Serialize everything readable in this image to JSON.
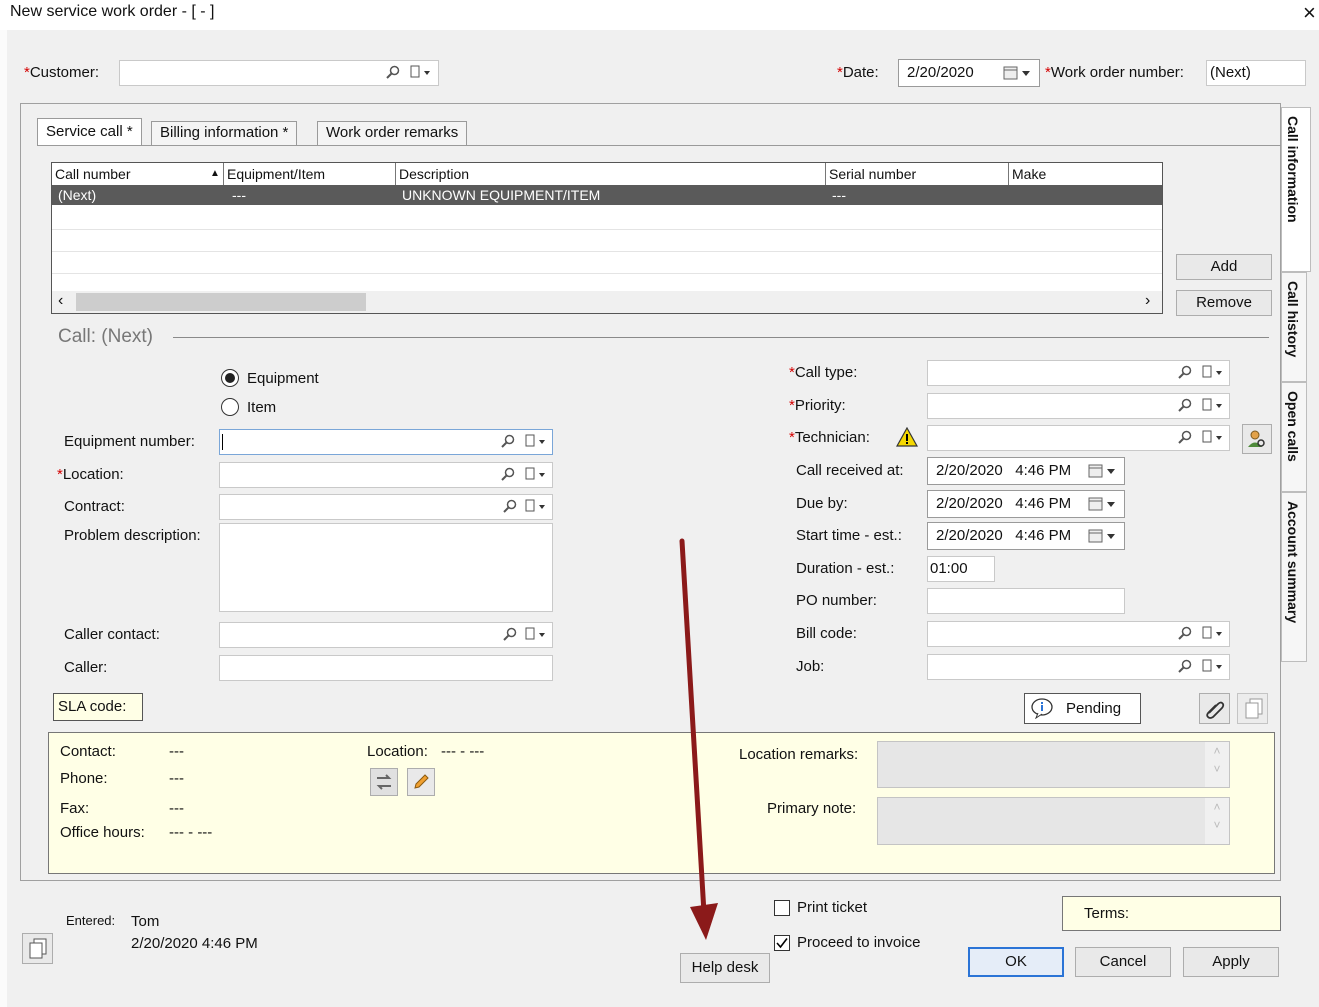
{
  "window": {
    "title": "New service work order - [ - ]",
    "close": "×"
  },
  "header": {
    "customer_label": "Customer:",
    "customer_value": "",
    "date_label": "Date:",
    "date_value": "2/20/2020",
    "wo_label": "Work order number:",
    "wo_value": "(Next)",
    "required_mark": "*"
  },
  "tabs": [
    {
      "label": "Service call *"
    },
    {
      "label": "Billing information  *"
    },
    {
      "label": "Work order remarks"
    }
  ],
  "side_tabs": [
    {
      "label": "Call information"
    },
    {
      "label": "Call history"
    },
    {
      "label": "Open calls"
    },
    {
      "label": "Account summary"
    }
  ],
  "grid": {
    "columns": [
      "Call number",
      "Equipment/Item",
      "Description",
      "Serial number",
      "Make"
    ],
    "rows": [
      {
        "call_number": "(Next)",
        "equipment": "---",
        "description": "UNKNOWN EQUIPMENT/ITEM",
        "serial": "---",
        "make": ""
      }
    ]
  },
  "grid_buttons": {
    "add": "Add",
    "remove": "Remove"
  },
  "call": {
    "title": "Call: (Next)"
  },
  "left_form": {
    "radio_equipment": "Equipment",
    "radio_item": "Item",
    "equipment_number": "Equipment number:",
    "location": "Location:",
    "contract": "Contract:",
    "problem_description": "Problem description:",
    "caller_contact": "Caller contact:",
    "caller": "Caller:",
    "sla_code": "SLA code:"
  },
  "right_form": {
    "call_type": "Call type:",
    "priority": "Priority:",
    "technician": "Technician:",
    "call_received": "Call received at:",
    "call_received_value": "2/20/2020   4:46 PM",
    "due_by": "Due by:",
    "due_by_value": "2/20/2020   4:46 PM",
    "start_time": "Start time - est.:",
    "start_time_value": "2/20/2020   4:46 PM",
    "duration": "Duration - est.:",
    "duration_value": "01:00",
    "po_number": "PO number:",
    "bill_code": "Bill code:",
    "job": "Job:"
  },
  "pending": "Pending",
  "info_panel": {
    "contact_label": "Contact:",
    "contact_value": "---",
    "phone_label": "Phone:",
    "phone_value": "---",
    "fax_label": "Fax:",
    "fax_value": "---",
    "hours_label": "Office hours:",
    "hours_value": "--- - ---",
    "location_label": "Location:",
    "location_value": "--- - ---",
    "location_remarks": "Location remarks:",
    "primary_note": "Primary note:"
  },
  "footer": {
    "entered_label": "Entered:",
    "entered_by": "Tom",
    "entered_date": "2/20/2020 4:46 PM",
    "help_desk": "Help desk",
    "print_ticket": "Print ticket",
    "proceed_invoice": "Proceed to invoice",
    "terms": "Terms:",
    "ok": "OK",
    "cancel": "Cancel",
    "apply": "Apply"
  },
  "colors": {
    "accent": "#2b74d6",
    "required": "#d40000",
    "info_bg": "#ffffe6",
    "annotation_arrow": "#8b1a1a"
  }
}
